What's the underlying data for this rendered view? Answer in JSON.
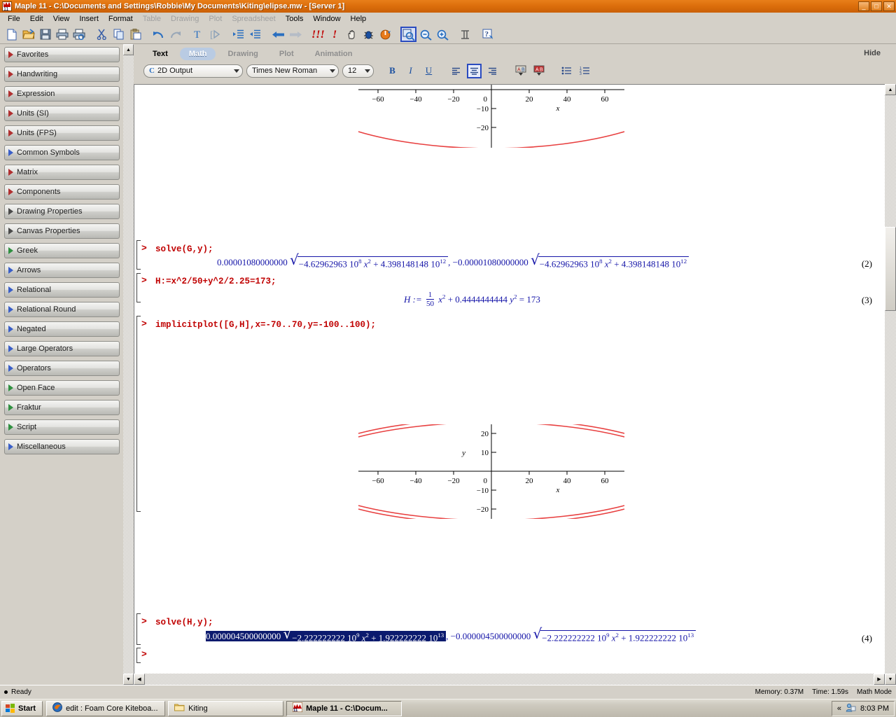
{
  "window": {
    "title": "Maple 11 - C:\\Documents and Settings\\Robbie\\My Documents\\Kiting\\elipse.mw - [Server 1]",
    "app_icon": "maple-icon",
    "minimize": "_",
    "maximize": "□",
    "close": "✕",
    "titlebar_color": "#dd6f0c"
  },
  "menu": [
    {
      "label": "File",
      "disabled": false
    },
    {
      "label": "Edit",
      "disabled": false
    },
    {
      "label": "View",
      "disabled": false
    },
    {
      "label": "Insert",
      "disabled": false
    },
    {
      "label": "Format",
      "disabled": false
    },
    {
      "label": "Table",
      "disabled": true
    },
    {
      "label": "Drawing",
      "disabled": true
    },
    {
      "label": "Plot",
      "disabled": true
    },
    {
      "label": "Spreadsheet",
      "disabled": true
    },
    {
      "label": "Tools",
      "disabled": false
    },
    {
      "label": "Window",
      "disabled": false
    },
    {
      "label": "Help",
      "disabled": false
    }
  ],
  "toolbar": [
    {
      "name": "new-icon",
      "selected": false
    },
    {
      "name": "open-icon",
      "selected": false
    },
    {
      "name": "save-icon",
      "selected": false
    },
    {
      "name": "print-icon",
      "selected": false
    },
    {
      "name": "print-preview-icon",
      "selected": false
    },
    {
      "name": "cut-icon",
      "selected": false
    },
    {
      "name": "copy-icon",
      "selected": false
    },
    {
      "name": "paste-icon",
      "selected": false
    },
    {
      "name": "undo-icon",
      "selected": false
    },
    {
      "name": "redo-icon",
      "selected": false
    },
    {
      "name": "text-mode-icon",
      "selected": false
    },
    {
      "name": "math-mode-icon",
      "selected": false
    },
    {
      "name": "indent-icon",
      "selected": false
    },
    {
      "name": "outdent-icon",
      "selected": false
    },
    {
      "name": "back-icon",
      "selected": false
    },
    {
      "name": "forward-icon",
      "selected": false
    },
    {
      "name": "execute-all-icon",
      "selected": false
    },
    {
      "name": "execute-icon",
      "selected": false
    },
    {
      "name": "stop-icon",
      "selected": false
    },
    {
      "name": "debug-icon",
      "selected": false
    },
    {
      "name": "restart-icon",
      "selected": false
    },
    {
      "name": "zoom-fit-icon",
      "selected": true
    },
    {
      "name": "zoom-out-icon",
      "selected": false
    },
    {
      "name": "zoom-in-icon",
      "selected": false
    },
    {
      "name": "non-executable-icon",
      "selected": false
    },
    {
      "name": "help-icon",
      "selected": false
    }
  ],
  "palette": {
    "items": [
      {
        "label": "Favorites",
        "marker": "red"
      },
      {
        "label": "Handwriting",
        "marker": "red"
      },
      {
        "label": "Expression",
        "marker": "red"
      },
      {
        "label": "Units (SI)",
        "marker": "red"
      },
      {
        "label": "Units (FPS)",
        "marker": "red"
      },
      {
        "label": "Common Symbols",
        "marker": "blue"
      },
      {
        "label": "Matrix",
        "marker": "red"
      },
      {
        "label": "Components",
        "marker": "red"
      },
      {
        "label": "Drawing Properties",
        "marker": "dark"
      },
      {
        "label": "Canvas Properties",
        "marker": "dark"
      },
      {
        "label": "Greek",
        "marker": "green"
      },
      {
        "label": "Arrows",
        "marker": "blue"
      },
      {
        "label": "Relational",
        "marker": "blue"
      },
      {
        "label": "Relational Round",
        "marker": "blue"
      },
      {
        "label": "Negated",
        "marker": "blue"
      },
      {
        "label": "Large Operators",
        "marker": "blue"
      },
      {
        "label": "Operators",
        "marker": "blue"
      },
      {
        "label": "Open Face",
        "marker": "green"
      },
      {
        "label": "Fraktur",
        "marker": "green"
      },
      {
        "label": "Script",
        "marker": "green"
      },
      {
        "label": "Miscellaneous",
        "marker": "blue"
      }
    ]
  },
  "context_bar": {
    "tabs": [
      {
        "label": "Text",
        "active": false
      },
      {
        "label": "Math",
        "active": true
      },
      {
        "label": "Drawing",
        "active": false
      },
      {
        "label": "Plot",
        "active": false
      },
      {
        "label": "Animation",
        "active": false
      }
    ],
    "hide_label": "Hide",
    "style_combo": {
      "prefix": "C",
      "value": "2D Output"
    },
    "font_combo": {
      "value": "Times New Roman"
    },
    "size_combo": {
      "value": "12"
    },
    "bold": "B",
    "italic": "I",
    "underline": "U",
    "align_left": "align-left-icon",
    "align_center": "align-center-icon",
    "align_right": "align-right-icon",
    "color_a": "text-color-icon",
    "color_b": "highlight-color-icon",
    "bullet_list": "bullet-list-icon",
    "numbered_list": "numbered-list-icon"
  },
  "worksheet": {
    "input_2": "solve(G,y);",
    "input_3": "H:=x^2/50+y^2/2.25=173;",
    "input_4": "implicitplot([G,H],x=-70..70,y=-100..100);",
    "input_5": "solve(H,y);",
    "label_2": "(2)",
    "label_3": "(3)",
    "label_4": "(4)",
    "output_2": {
      "coeff_1": "0.00001080000000",
      "radicand_1": {
        "a": "−4.62962963",
        "apow": "8",
        "b": "+ 4.398148148",
        "bpow": "12"
      },
      "sep": ", ",
      "coeff_2": "−0.00001080000000",
      "radicand_2": {
        "a": "−4.62962963",
        "apow": "8",
        "b": "+ 4.398148148",
        "bpow": "12"
      }
    },
    "output_3": {
      "lhs": "H :=",
      "num": "1",
      "den": "50",
      "term1_var": "x",
      "term1_pow": "2",
      "plus": "+",
      "coeff2": "0.4444444444",
      "term2_var": "y",
      "term2_pow": "2",
      "equals": "= 173"
    },
    "output_4": {
      "coeff_1": "0.000004500000000",
      "radicand_1": {
        "a": "−2.222222222",
        "apow": "9",
        "b": "+ 1.922222222",
        "bpow": "13"
      },
      "sep": ",",
      "coeff_2": "−0.000004500000000",
      "radicand_2": {
        "a": "−2.222222222",
        "apow": "9",
        "b": "+ 1.922222222",
        "bpow": "13"
      },
      "selected_part": "first"
    },
    "ten": "10",
    "x_var": "x",
    "prompt_char": ">"
  },
  "chart_data": [
    {
      "type": "line",
      "title": "",
      "name": "implicitplot-upper-clipped",
      "xlabel": "x",
      "ylabel": "",
      "xlim": [
        -70,
        70
      ],
      "ylim": [
        -24,
        0
      ],
      "xticks": [
        -60,
        -40,
        -20,
        0,
        20,
        40,
        60
      ],
      "yticks": [
        0,
        -10,
        -20
      ],
      "grid": false,
      "curve_color": "#e84040",
      "series": [
        {
          "name": "G lower branch",
          "x": [
            -70,
            -60,
            -50,
            -40,
            -30,
            -20,
            -10,
            0,
            10,
            20,
            30,
            40,
            50,
            60,
            70
          ],
          "y": [
            -14.8,
            -17.2,
            -19.0,
            -20.3,
            -21.2,
            -21.7,
            -21.9,
            -22.0,
            -21.9,
            -21.7,
            -21.2,
            -20.3,
            -19.0,
            -17.2,
            -14.8
          ]
        }
      ]
    },
    {
      "type": "line",
      "title": "",
      "name": "implicitplot-G-and-H",
      "xlabel": "x",
      "ylabel": "y",
      "xlim": [
        -70,
        70
      ],
      "ylim": [
        -24,
        24
      ],
      "xticks": [
        -60,
        -40,
        -20,
        0,
        20,
        40,
        60
      ],
      "yticks": [
        20,
        10,
        0,
        -10,
        -20
      ],
      "grid": false,
      "curve_color": "#e84040",
      "series": [
        {
          "name": "G upper branch",
          "x": [
            -70,
            -60,
            -50,
            -40,
            -30,
            -20,
            -10,
            0,
            10,
            20,
            30,
            40,
            50,
            60,
            70
          ],
          "y": [
            14.8,
            17.2,
            19.0,
            20.3,
            21.2,
            21.7,
            21.9,
            22.0,
            21.9,
            21.7,
            21.2,
            20.3,
            19.0,
            17.2,
            14.8
          ]
        },
        {
          "name": "H upper branch",
          "x": [
            -70,
            -60,
            -50,
            -40,
            -30,
            -20,
            -10,
            0,
            10,
            20,
            30,
            40,
            50,
            60,
            70
          ],
          "y": [
            13.0,
            15.6,
            17.5,
            18.9,
            19.8,
            20.4,
            20.6,
            20.7,
            20.6,
            20.4,
            19.8,
            18.9,
            17.5,
            15.6,
            13.0
          ]
        },
        {
          "name": "G lower branch",
          "x": [
            -70,
            -60,
            -50,
            -40,
            -30,
            -20,
            -10,
            0,
            10,
            20,
            30,
            40,
            50,
            60,
            70
          ],
          "y": [
            -14.8,
            -17.2,
            -19.0,
            -20.3,
            -21.2,
            -21.7,
            -21.9,
            -22.0,
            -21.9,
            -21.7,
            -21.2,
            -20.3,
            -19.0,
            -17.2,
            -14.8
          ]
        },
        {
          "name": "H lower branch",
          "x": [
            -70,
            -60,
            -50,
            -40,
            -30,
            -20,
            -10,
            0,
            10,
            20,
            30,
            40,
            50,
            60,
            70
          ],
          "y": [
            -13.0,
            -15.6,
            -17.5,
            -18.9,
            -19.8,
            -20.4,
            -20.6,
            -20.7,
            -20.6,
            -20.4,
            -19.8,
            -18.9,
            -17.5,
            -15.6,
            -13.0
          ]
        }
      ]
    }
  ],
  "statusbar": {
    "status": "Ready",
    "memory": "Memory: 0.37M",
    "time": "Time: 1.59s",
    "mode": "Math Mode"
  },
  "taskbar": {
    "start": "Start",
    "tasks": [
      {
        "label": "edit : Foam Core Kiteboa...",
        "icon": "firefox-icon",
        "active": false
      },
      {
        "label": "Kiting",
        "icon": "folder-icon",
        "active": false
      },
      {
        "label": "Maple 11 - C:\\Docum...",
        "icon": "maple-icon",
        "active": true
      }
    ],
    "tray_expand": "«",
    "tray_icon": "user-accounts-icon",
    "clock": "8:03 PM"
  }
}
